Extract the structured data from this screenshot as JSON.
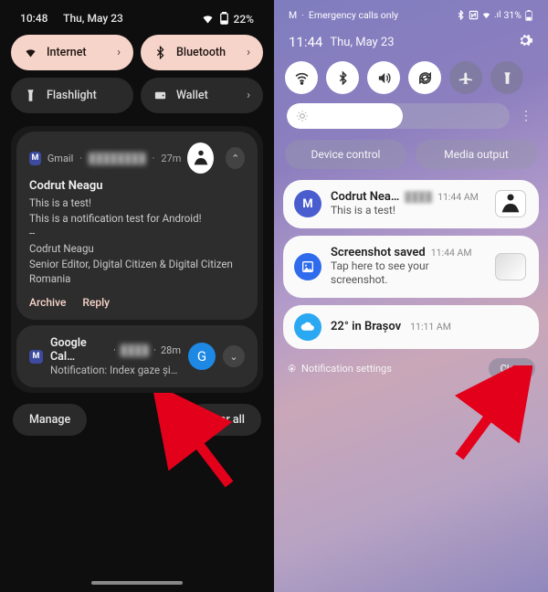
{
  "left": {
    "status": {
      "time": "10:48",
      "date": "Thu, May 23",
      "battery": "22%"
    },
    "tiles": [
      {
        "id": "internet",
        "label": "Internet",
        "active": true
      },
      {
        "id": "bluetooth",
        "label": "Bluetooth",
        "active": true
      },
      {
        "id": "flashlight",
        "label": "Flashlight",
        "active": false
      },
      {
        "id": "wallet",
        "label": "Wallet",
        "active": false
      }
    ],
    "gmail": {
      "app": "Gmail",
      "time": "27m",
      "title": "Codrut Neagu",
      "line1": "This is a test!",
      "line2": "This is a notification test for Android!",
      "sep": "--",
      "sig1": "Codrut Neagu",
      "sig2": "Senior Editor, Digital Citizen & Digital Citizen Romania",
      "actions": {
        "archive": "Archive",
        "reply": "Reply"
      }
    },
    "calendar": {
      "app": "Google Cal…",
      "time": "28m",
      "body": "Notification: Index gaze și cure…",
      "avatar_letter": "G"
    },
    "buttons": {
      "manage": "Manage",
      "clear_all": "Clear all"
    }
  },
  "right": {
    "status": {
      "carrier": "M",
      "emergency": "Emergency calls only",
      "battery": "31%"
    },
    "time": "11:44",
    "date": "Thu, May 23",
    "qs": [
      {
        "id": "wifi",
        "on": true
      },
      {
        "id": "bluetooth",
        "on": true
      },
      {
        "id": "sound",
        "on": true
      },
      {
        "id": "rotate",
        "on": true
      },
      {
        "id": "airplane",
        "on": false
      },
      {
        "id": "flashlight",
        "on": false
      }
    ],
    "wide_buttons": {
      "device": "Device control",
      "media": "Media output"
    },
    "notifications": [
      {
        "icon": "gmail",
        "title": "Codrut Nea…",
        "time": "11:44 AM",
        "sub": "This is a test!"
      },
      {
        "icon": "screenshot",
        "title": "Screenshot saved",
        "time": "11:44 AM",
        "sub": "Tap here to see your screenshot."
      },
      {
        "icon": "weather",
        "title": "22° in Brașov",
        "time": "11:11 AM",
        "sub": ""
      }
    ],
    "footer": {
      "settings": "Notification settings",
      "clear": "Clear"
    }
  }
}
